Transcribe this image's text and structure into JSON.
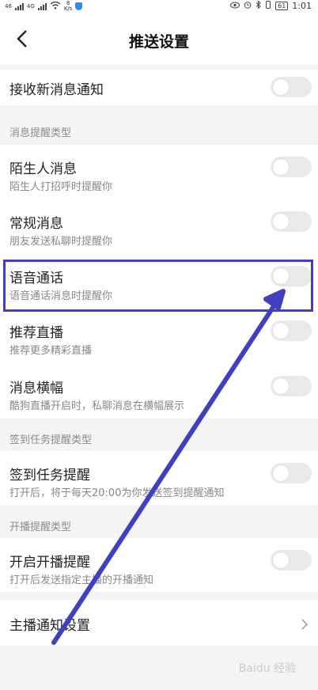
{
  "status_bar": {
    "network_left": "46",
    "network_right": "4G",
    "speed_value": "8",
    "speed_unit": "K/s",
    "battery": "61",
    "time": "1:01"
  },
  "nav": {
    "title": "推送设置"
  },
  "new_message": {
    "title": "接收新消息通知",
    "enabled": false
  },
  "sections": {
    "message_type": "消息提醒类型",
    "checkin_type": "签到任务提醒类型",
    "live_type": "开播提醒类型"
  },
  "items": {
    "stranger": {
      "title": "陌生人消息",
      "desc": "陌生人打招呼时提醒你",
      "enabled": false
    },
    "regular": {
      "title": "常规消息",
      "desc": "朋友发送私聊时提醒你",
      "enabled": false
    },
    "voice": {
      "title": "语音通话",
      "desc": "语音通话消息时提醒你",
      "enabled": false
    },
    "recommend": {
      "title": "推荐直播",
      "desc": "推荐更多精彩直播",
      "enabled": false
    },
    "banner": {
      "title": "消息横幅",
      "desc": "酷狗直播开启时，私聊消息在横幅展示",
      "enabled": false
    },
    "checkin": {
      "title": "签到任务提醒",
      "desc": "打开后，将于每天20:00为你发送签到提醒通知",
      "enabled": false
    },
    "live": {
      "title": "开启开播提醒",
      "desc": "打开后发送指定主播的开播通知",
      "enabled": false
    }
  },
  "anchor_settings": {
    "title": "主播通知设置"
  },
  "annotation": {
    "color": "#3f3fbf"
  },
  "watermark": "Baidu 经验"
}
